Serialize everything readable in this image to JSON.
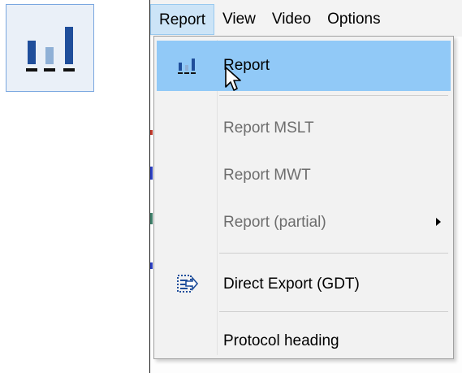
{
  "menubar": {
    "items": [
      "Report",
      "View",
      "Video",
      "Options"
    ],
    "active_index": 0
  },
  "dropdown": {
    "items": [
      {
        "label": "Report",
        "icon": "bar-chart-icon",
        "enabled": true,
        "highlighted": true
      },
      {
        "label": "Report MSLT",
        "enabled": false
      },
      {
        "label": "Report MWT",
        "enabled": false
      },
      {
        "label": "Report (partial)",
        "enabled": false,
        "has_submenu": true
      },
      {
        "label": "Direct Export (GDT)",
        "icon": "export-icon",
        "enabled": true
      },
      {
        "label": "Protocol heading",
        "enabled": true
      }
    ]
  },
  "toolbar": {
    "large_icon": "bar-chart-icon"
  },
  "colors": {
    "menu_highlight": "#91c9f7",
    "menubar_active": "#cce4f7",
    "icon_dark_blue": "#1f4e9b",
    "icon_light_blue": "#8fb0d6"
  }
}
